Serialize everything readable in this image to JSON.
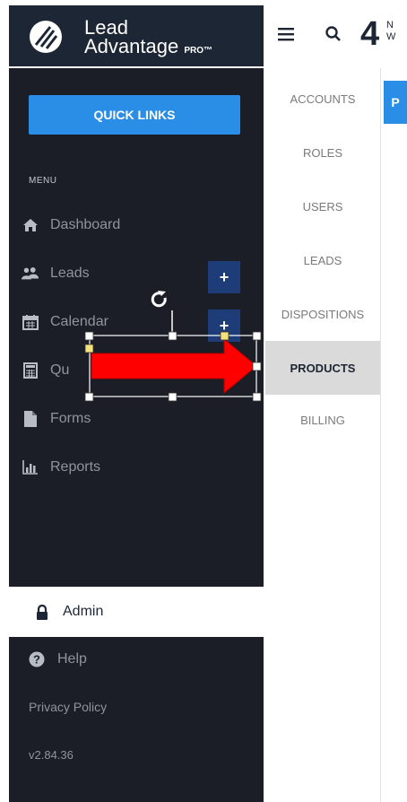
{
  "brand": {
    "name_line1": "Lead",
    "name_line2": "Advantage",
    "suffix": "PRO™"
  },
  "topbar": {
    "number": "4",
    "text_line1": "N",
    "text_line2": "W"
  },
  "sidebar": {
    "quick_links": "QUICK LINKS",
    "menu_label": "MENU",
    "items": [
      {
        "label": "Dashboard",
        "icon": "home-icon"
      },
      {
        "label": "Leads",
        "icon": "users-icon"
      },
      {
        "label": "Calendar",
        "icon": "calendar-icon"
      },
      {
        "label": "Qu",
        "icon": "calculator-icon"
      },
      {
        "label": "Forms",
        "icon": "file-icon"
      },
      {
        "label": "Reports",
        "icon": "bar-chart-icon"
      }
    ],
    "plus": "+",
    "admin": "Admin",
    "help": "Help",
    "privacy": "Privacy Policy",
    "version": "v2.84.36"
  },
  "submenu": {
    "items": [
      "ACCOUNTS",
      "ROLES",
      "USERS",
      "LEADS",
      "DISPOSITIONS",
      "PRODUCTS",
      "BILLING"
    ],
    "active": "PRODUCTS"
  },
  "content": {
    "tab_initial": "P"
  },
  "colors": {
    "sidebar": "#1b1e26",
    "brand": "#1d2634",
    "accent": "#2b8ee6",
    "plus": "#1e3d78",
    "arrow": "#ff0000",
    "active_sub": "#dadada"
  }
}
